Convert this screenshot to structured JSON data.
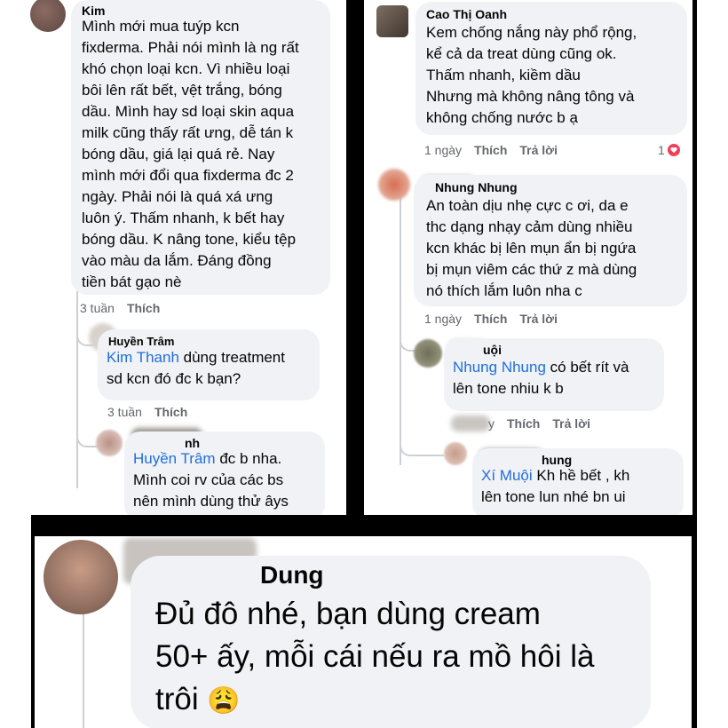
{
  "left": {
    "c1": {
      "name": "Kim",
      "text": "Mình mới mua tuýp kcn\nfixderma. Phải nói mình là ng rất\nkhó chọn loại kcn. Vì nhiều loại\nbôi lên rất bết, vệt trắng, bóng\ndầu. Mình hay sd loại skin aqua\nmilk cũng thấy rất ưng, dễ tán k\nbóng dầu, giá lại quá rẻ. Nay\nmình mới đổi qua fixderma đc 2\nngày. Phải nói là quá xá ưng\nluôn ý. Thấm nhanh, k bết hay\nbóng dầu. K nâng tone, kiểu tệp\nvào màu da lắm. Đáng đồng\ntiền bát gạo nè",
      "time": "3 tuần",
      "like": "Thích"
    },
    "r1": {
      "name": "Huyền Trâm",
      "mention": "Kim Thanh",
      "text": " dùng treatment\nsd kcn đó đc k bạn?",
      "time": "3 tuần",
      "like": "Thích"
    },
    "r2": {
      "name": "nh",
      "mention": "Huyền Trâm",
      "text": " đc b nha.\nMình coi rv của các bs\nnên mình dùng thử âys"
    }
  },
  "right": {
    "c1": {
      "name": "Cao Thị Oanh",
      "text": "Kem chống nắng này phổ rộng,\nkể cả da treat dùng cũng ok.\nThấm nhanh, kiềm dầu\nNhưng mà không nâng tông và\nkhông chống nước b ạ",
      "time": "1 ngày",
      "like": "Thích",
      "reply": "Trả lời",
      "reactions": "1"
    },
    "c2": {
      "name": "Nhung Nhung",
      "text": "An toàn dịu nhẹ cực c ơi, da e\nthc dạng nhạy cảm dùng nhiều\nkcn khác bị lên mụn ẩn bị ngứa\nbị mụn viêm các thứ z mà dùng\nnó thích lắm luôn nha c",
      "time": "1 ngày",
      "like": "Thích",
      "reply": "Trả lời"
    },
    "r1": {
      "name": "uội",
      "mention": "Nhung Nhung",
      "text": " có bết rít và\nlên tone nhiu k b",
      "time": "y",
      "like": "Thích",
      "reply": "Trả lời"
    },
    "r2": {
      "name": "hung",
      "mention": "Xí Muội",
      "text": " Kh hề bết , kh\nlên tone lun nhé bn ui"
    }
  },
  "bottom": {
    "name": "Dung",
    "text": "Đủ đô nhé, bạn dùng cream\n50+ ấy, mỗi cái nếu ra mồ hôi là\ntrôi",
    "emoji": "😩"
  },
  "colors": {
    "mention": "#216fdb",
    "bubble": "#f0f2f5",
    "heart": "#f33e58"
  }
}
